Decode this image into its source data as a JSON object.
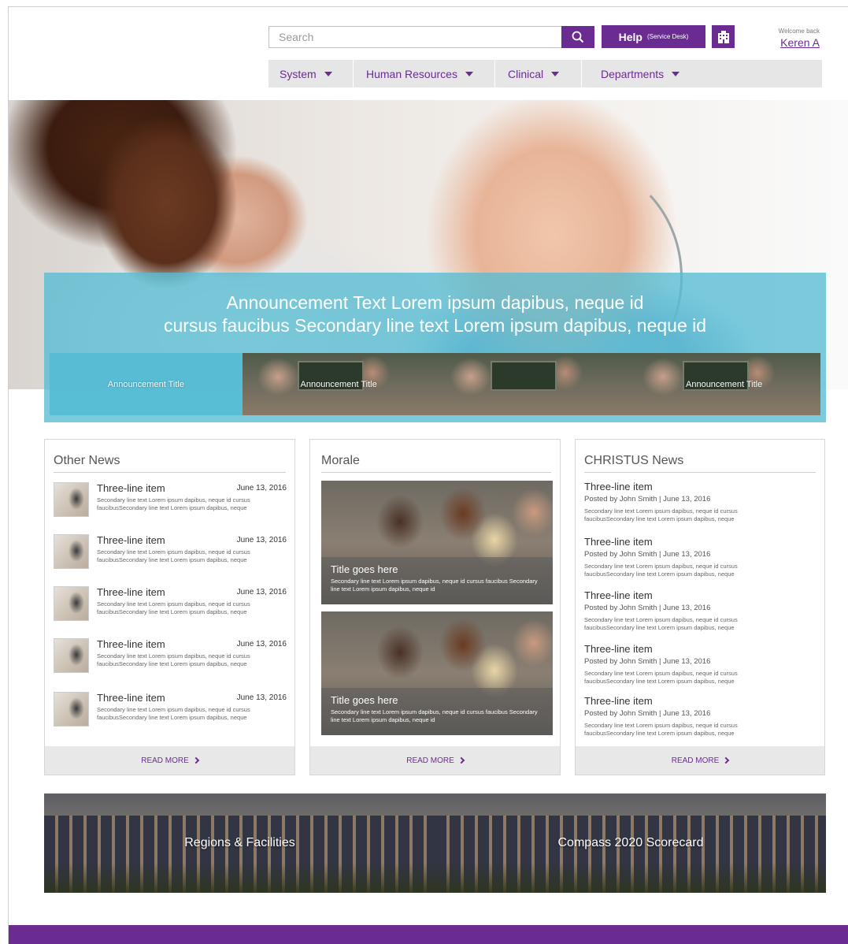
{
  "header": {
    "search": {
      "placeholder": "Search",
      "value": ""
    },
    "help": {
      "label": "Help",
      "sub_label": "(Service Desk)"
    },
    "welcome": {
      "greeting": "Welcome back",
      "user": "Keren A"
    }
  },
  "nav": {
    "items": [
      {
        "label": "System"
      },
      {
        "label": "Human Resources"
      },
      {
        "label": "Clinical"
      },
      {
        "label": "Departments"
      }
    ]
  },
  "hero": {
    "announcement": {
      "line1": "Announcement Text Lorem ipsum dapibus, neque id",
      "line2": "cursus faucibus Secondary line text Lorem ipsum dapibus, neque id"
    },
    "thumbnails": [
      {
        "label": "Announcement Title"
      },
      {
        "label": "Announcement Title"
      },
      {
        "label": ""
      },
      {
        "label": "Announcement Title"
      }
    ]
  },
  "other_news": {
    "title": "Other News",
    "items": [
      {
        "heading": "Three-line item",
        "date": "June 13, 2016",
        "body": "Secondary line text Lorem ipsum dapibus, neque id cursus faucibusSecondary line text Lorem ipsum dapibus, neque"
      },
      {
        "heading": "Three-line item",
        "date": "June 13, 2016",
        "body": "Secondary line text Lorem ipsum dapibus, neque id cursus faucibusSecondary line text Lorem ipsum dapibus, neque"
      },
      {
        "heading": "Three-line item",
        "date": "June 13, 2016",
        "body": "Secondary line text Lorem ipsum dapibus, neque id cursus faucibusSecondary line text Lorem ipsum dapibus, neque"
      },
      {
        "heading": "Three-line item",
        "date": "June 13, 2016",
        "body": "Secondary line text Lorem ipsum dapibus, neque id cursus faucibusSecondary line text Lorem ipsum dapibus, neque"
      },
      {
        "heading": "Three-line item",
        "date": "June 13, 2016",
        "body": "Secondary line text Lorem ipsum dapibus, neque id cursus faucibusSecondary line text Lorem ipsum dapibus, neque"
      }
    ],
    "read_more": "READ MORE"
  },
  "morale": {
    "title": "Morale",
    "items": [
      {
        "title": "Title goes here",
        "body": "Secondary line text Lorem ipsum dapibus, neque id cursus faucibus Secondary line text Lorem ipsum dapibus, neque id"
      },
      {
        "title": "Title goes here",
        "body": "Secondary line text Lorem ipsum dapibus, neque id cursus faucibus Secondary line text Lorem ipsum dapibus, neque id"
      }
    ],
    "read_more": "READ MORE"
  },
  "christus_news": {
    "title": "CHRISTUS News",
    "items": [
      {
        "heading": "Three-line item",
        "meta": "Posted by John Smith | June 13, 2016",
        "body": "Secondary line text Lorem ipsum dapibus, neque id cursus faucibusSecondary line text Lorem ipsum dapibus, neque"
      },
      {
        "heading": "Three-line item",
        "meta": "Posted by John Smith | June 13, 2016",
        "body": "Secondary line text Lorem ipsum dapibus, neque id cursus faucibusSecondary line text Lorem ipsum dapibus, neque"
      },
      {
        "heading": "Three-line item",
        "meta": "Posted by John Smith | June 13, 2016",
        "body": "Secondary line text Lorem ipsum dapibus, neque id cursus faucibusSecondary line text Lorem ipsum dapibus, neque"
      },
      {
        "heading": "Three-line item",
        "meta": "Posted by John Smith | June 13, 2016",
        "body": "Secondary line text Lorem ipsum dapibus, neque id cursus faucibusSecondary line text Lorem ipsum dapibus, neque"
      },
      {
        "heading": "Three-line item",
        "meta": "Posted by John Smith | June 13, 2016",
        "body": "Secondary line text Lorem ipsum dapibus, neque id cursus faucibusSecondary line text Lorem ipsum dapibus, neque"
      }
    ],
    "read_more": "READ MORE"
  },
  "tiles": [
    {
      "label": "Regions & Facilities"
    },
    {
      "label": "Compass 2020 Scorecard"
    }
  ],
  "colors": {
    "brand_purple": "#6a2c91",
    "announcement_teal": "#56bdd4",
    "nav_gray": "#e6e6e6"
  },
  "icons": {
    "search": "search-icon",
    "building": "building-icon",
    "caret": "caret-down-icon",
    "chevron": "chevron-right-icon"
  }
}
